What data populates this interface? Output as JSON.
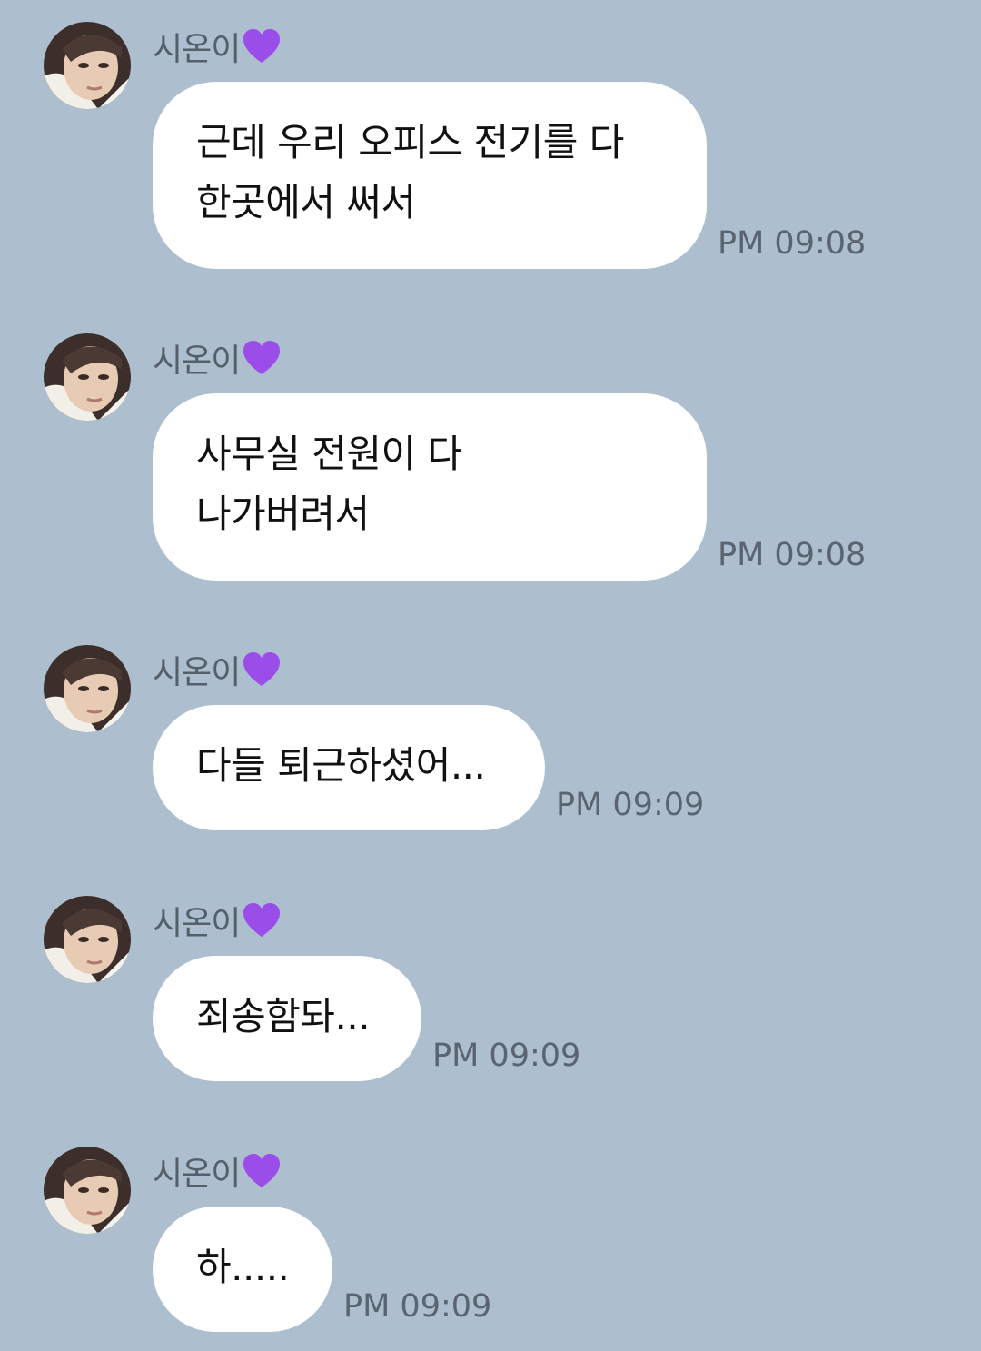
{
  "chat": {
    "messages": [
      {
        "sender": "시온이",
        "sender_emoji": "purple-heart",
        "text": "근데 우리 오피스 전기를 다\n한곳에서 써서",
        "time": "PM 09:08"
      },
      {
        "sender": "시온이",
        "sender_emoji": "purple-heart",
        "text": "사무실 전원이 다\n나가버려서",
        "time": "PM 09:08"
      },
      {
        "sender": "시온이",
        "sender_emoji": "purple-heart",
        "text": "다들 퇴근하셨어...",
        "time": "PM 09:09"
      },
      {
        "sender": "시온이",
        "sender_emoji": "purple-heart",
        "text": "죄송함돠...",
        "time": "PM 09:09"
      },
      {
        "sender": "시온이",
        "sender_emoji": "purple-heart",
        "text": "하.....",
        "time": "PM 09:09"
      }
    ]
  },
  "colors": {
    "background": "#adbfcf",
    "bubble": "#ffffff",
    "heart": "#9b4dea",
    "sender_text": "#555f69",
    "time_text": "#5a6470"
  },
  "icons": {
    "avatar": "profile-photo",
    "heart": "purple-heart-icon"
  }
}
